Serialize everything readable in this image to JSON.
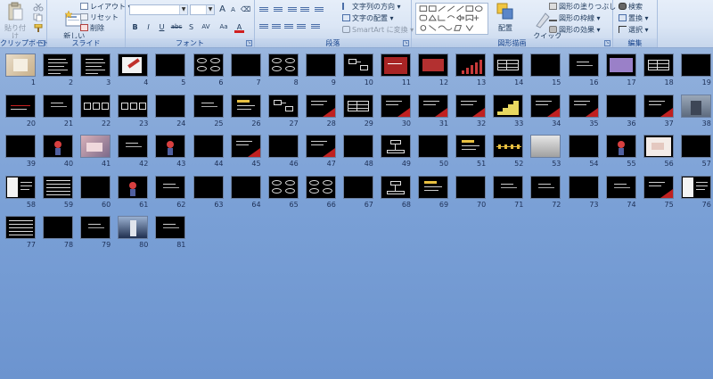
{
  "ribbon": {
    "clipboard": {
      "label": "クリップボード",
      "paste": "貼り付け"
    },
    "slides": {
      "label": "スライド",
      "new_slide": "新しい\nスライド",
      "layout": "レイアウト",
      "reset": "リセット",
      "delete": "削除"
    },
    "font": {
      "label": "フォント",
      "grow": "A",
      "shrink": "A",
      "bold": "B",
      "italic": "I",
      "underline": "U",
      "strike": "abc",
      "shadow": "S",
      "spacing": "AV",
      "case": "Aa",
      "color": "A"
    },
    "paragraph": {
      "label": "段落",
      "text_direction": "文字列の方向",
      "align_text": "文字の配置",
      "smartart": "SmartArt に変換"
    },
    "drawing": {
      "label": "図形描画",
      "arrange": "配置",
      "quick_styles": "クイック\nスタイル",
      "shape_fill": "図形の塗りつぶし",
      "shape_outline": "図形の枠線",
      "shape_effects": "図形の効果"
    },
    "editing": {
      "label": "編集",
      "find": "検索",
      "replace": "置換",
      "select": "選択"
    }
  },
  "colors": {
    "ribbon_text": "#15428b",
    "thumb_bg": "#000000",
    "accent_red": "#b22222"
  },
  "slides": [
    {
      "n": "1",
      "t": "photo"
    },
    {
      "n": "2",
      "t": "text"
    },
    {
      "n": "3",
      "t": "text"
    },
    {
      "n": "4",
      "t": "pencil"
    },
    {
      "n": "5",
      "t": "blank"
    },
    {
      "n": "6",
      "t": "bubbles"
    },
    {
      "n": "7",
      "t": "blank"
    },
    {
      "n": "8",
      "t": "bubbles"
    },
    {
      "n": "9",
      "t": "blank"
    },
    {
      "n": "10",
      "t": "diagram"
    },
    {
      "n": "11",
      "t": "redpanel"
    },
    {
      "n": "12",
      "t": "redbox"
    },
    {
      "n": "13",
      "t": "barchart"
    },
    {
      "n": "14",
      "t": "table"
    },
    {
      "n": "15",
      "t": "blank"
    },
    {
      "n": "16",
      "t": "textsmall"
    },
    {
      "n": "17",
      "t": "purple"
    },
    {
      "n": "18",
      "t": "table"
    },
    {
      "n": "19",
      "t": "blank"
    },
    {
      "n": "20",
      "t": "redline"
    },
    {
      "n": "21",
      "t": "textsmall"
    },
    {
      "n": "22",
      "t": "boxes"
    },
    {
      "n": "23",
      "t": "boxes"
    },
    {
      "n": "24",
      "t": "blank"
    },
    {
      "n": "25",
      "t": "textsmall"
    },
    {
      "n": "26",
      "t": "yellowtext"
    },
    {
      "n": "27",
      "t": "diagram"
    },
    {
      "n": "28",
      "t": "redcorner"
    },
    {
      "n": "29",
      "t": "table"
    },
    {
      "n": "30",
      "t": "redcorner"
    },
    {
      "n": "31",
      "t": "redcorner"
    },
    {
      "n": "32",
      "t": "redcorner"
    },
    {
      "n": "33",
      "t": "stairs"
    },
    {
      "n": "34",
      "t": "redcorner"
    },
    {
      "n": "35",
      "t": "redcorner"
    },
    {
      "n": "36",
      "t": "blank"
    },
    {
      "n": "37",
      "t": "redcorner"
    },
    {
      "n": "38",
      "t": "photo2"
    },
    {
      "n": "39",
      "t": "blank"
    },
    {
      "n": "40",
      "t": "figure"
    },
    {
      "n": "41",
      "t": "photo3"
    },
    {
      "n": "42",
      "t": "textsmall"
    },
    {
      "n": "43",
      "t": "figure"
    },
    {
      "n": "44",
      "t": "blank"
    },
    {
      "n": "45",
      "t": "redcorner"
    },
    {
      "n": "46",
      "t": "blank"
    },
    {
      "n": "47",
      "t": "redcorner"
    },
    {
      "n": "48",
      "t": "blank"
    },
    {
      "n": "49",
      "t": "tree"
    },
    {
      "n": "50",
      "t": "blank"
    },
    {
      "n": "51",
      "t": "yellowtext"
    },
    {
      "n": "52",
      "t": "timeline"
    },
    {
      "n": "53",
      "t": "gray"
    },
    {
      "n": "54",
      "t": "blank"
    },
    {
      "n": "55",
      "t": "figure"
    },
    {
      "n": "56",
      "t": "pink"
    },
    {
      "n": "57",
      "t": "blank"
    },
    {
      "n": "58",
      "t": "paper"
    },
    {
      "n": "59",
      "t": "textblock"
    },
    {
      "n": "60",
      "t": "blank"
    },
    {
      "n": "61",
      "t": "figure"
    },
    {
      "n": "62",
      "t": "textsmall"
    },
    {
      "n": "63",
      "t": "blank"
    },
    {
      "n": "64",
      "t": "blank"
    },
    {
      "n": "65",
      "t": "bubbles"
    },
    {
      "n": "66",
      "t": "bubbles"
    },
    {
      "n": "67",
      "t": "blank"
    },
    {
      "n": "68",
      "t": "tree"
    },
    {
      "n": "69",
      "t": "yellowtext"
    },
    {
      "n": "70",
      "t": "blank"
    },
    {
      "n": "71",
      "t": "textsmall"
    },
    {
      "n": "72",
      "t": "textsmall"
    },
    {
      "n": "73",
      "t": "blank"
    },
    {
      "n": "74",
      "t": "textsmall"
    },
    {
      "n": "75",
      "t": "redcorner"
    },
    {
      "n": "76",
      "t": "paper"
    },
    {
      "n": "77",
      "t": "textblock"
    },
    {
      "n": "78",
      "t": "blank"
    },
    {
      "n": "79",
      "t": "textsmall"
    },
    {
      "n": "80",
      "t": "person"
    },
    {
      "n": "81",
      "t": "textsmall"
    }
  ]
}
